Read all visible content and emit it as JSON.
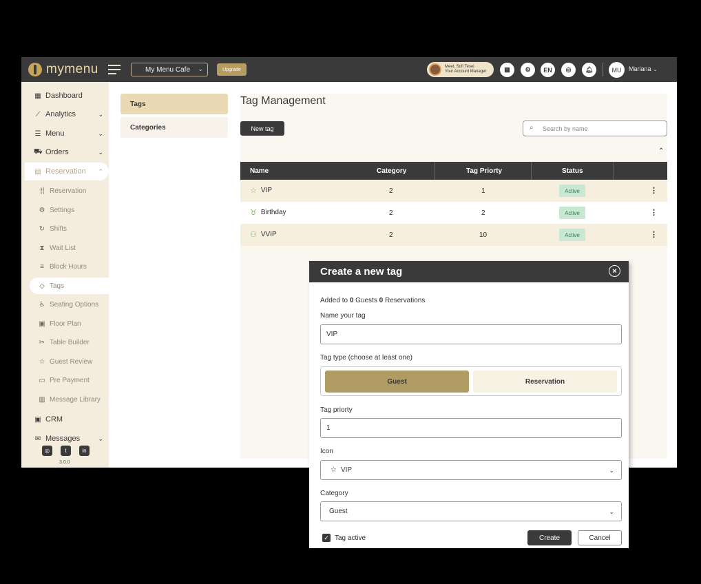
{
  "topbar": {
    "logo_text": "mymenu",
    "cafe": "My Menu Cafe",
    "upgrade": "Upgrade",
    "manager_line1": "Meet, Sofi Tesei",
    "manager_line2": "Your Account Manager",
    "lang": "EN",
    "user_initials": "MU",
    "user_name": "Mariana"
  },
  "sidebar": {
    "items": [
      {
        "label": "Dashboard",
        "icon": "dashboard-icon"
      },
      {
        "label": "Analytics",
        "icon": "chart-icon"
      },
      {
        "label": "Menu",
        "icon": "menu-icon"
      },
      {
        "label": "Orders",
        "icon": "cart-icon"
      },
      {
        "label": "Reservation",
        "icon": "calendar-icon"
      }
    ],
    "sub_items": [
      {
        "label": "Reservation"
      },
      {
        "label": "Settings"
      },
      {
        "label": "Shifts"
      },
      {
        "label": "Wait List"
      },
      {
        "label": "Block Hours"
      },
      {
        "label": "Tags"
      },
      {
        "label": "Seating Options"
      },
      {
        "label": "Floor Plan"
      },
      {
        "label": "Table Builder"
      },
      {
        "label": "Guest Review"
      },
      {
        "label": "Pre Payment"
      },
      {
        "label": "Message Library"
      }
    ],
    "crm": "CRM",
    "messages": "Messages",
    "version": "3.0.0"
  },
  "tabs": [
    "Tags",
    "Categories"
  ],
  "main": {
    "title": "Tag Management",
    "new_tag": "New tag",
    "search_placeholder": "Search by name",
    "columns": [
      "Name",
      "Category",
      "Tag Priorty",
      "Status"
    ],
    "rows": [
      {
        "name": "VIP",
        "icon": "star-icon",
        "category": "2",
        "priority": "1",
        "status": "Active"
      },
      {
        "name": "Birthday",
        "icon": "gift-icon",
        "category": "2",
        "priority": "2",
        "status": "Active"
      },
      {
        "name": "VVIP",
        "icon": "user-check-icon",
        "category": "2",
        "priority": "10",
        "status": "Active"
      }
    ]
  },
  "modal": {
    "title": "Create a new tag",
    "added_prefix": "Added to ",
    "added_guests": "0",
    "added_mid": " Guests ",
    "added_res": "0",
    "added_suffix": " Reservations",
    "name_label": "Name your tag",
    "name_value": "VIP",
    "type_label": "Tag type (choose at least one)",
    "type_guest": "Guest",
    "type_reservation": "Reservation",
    "priority_label": "Tag priorty",
    "priority_value": "1",
    "icon_label": "Icon",
    "icon_value": "VIP",
    "category_label": "Category",
    "category_value": "Guest",
    "active_label": "Tag active",
    "create": "Create",
    "cancel": "Cancel"
  }
}
